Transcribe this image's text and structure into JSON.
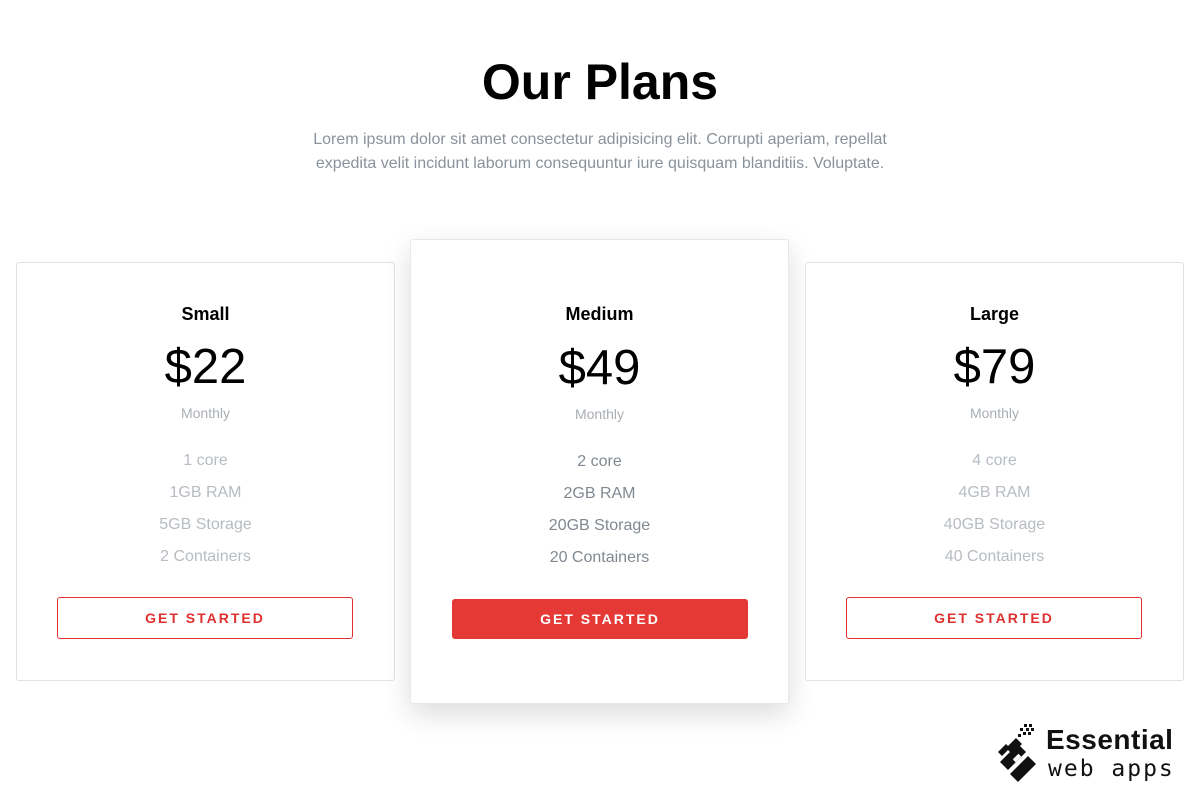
{
  "header": {
    "title": "Our Plans",
    "subtitle": "Lorem ipsum dolor sit amet consectetur adipisicing elit. Corrupti aperiam, repellat expedita velit incidunt laborum consequuntur iure quisquam blanditiis. Voluptate."
  },
  "plans": [
    {
      "name": "Small",
      "price": "$22",
      "period": "Monthly",
      "features": [
        "1 core",
        "1GB RAM",
        "5GB Storage",
        "2 Containers"
      ],
      "cta": "GET STARTED"
    },
    {
      "name": "Medium",
      "price": "$49",
      "period": "Monthly",
      "features": [
        "2 core",
        "2GB RAM",
        "20GB Storage",
        "20 Containers"
      ],
      "cta": "GET STARTED"
    },
    {
      "name": "Large",
      "price": "$79",
      "period": "Monthly",
      "features": [
        "4 core",
        "4GB RAM",
        "40GB Storage",
        "40 Containers"
      ],
      "cta": "GET STARTED"
    }
  ],
  "logo": {
    "line1": "Essential",
    "line2": "web apps",
    "icon": "essential-web-apps-logo-icon"
  },
  "colors": {
    "accent": "#e53935",
    "muted_text": "#8a929c",
    "card_border": "#dfe2e6"
  }
}
